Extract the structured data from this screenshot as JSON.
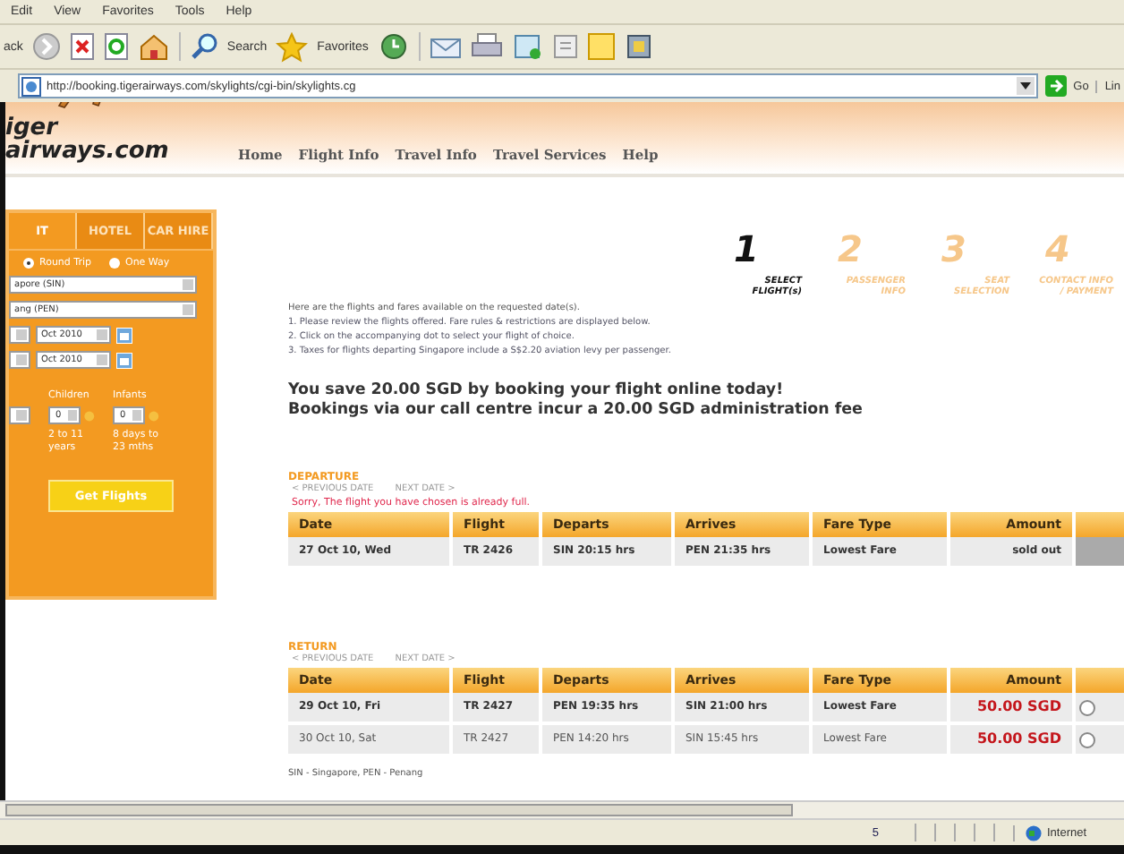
{
  "menu": [
    "Edit",
    "View",
    "Favorites",
    "Tools",
    "Help"
  ],
  "toolbar": {
    "back": "ack",
    "search": "Search",
    "favorites": "Favorites"
  },
  "address": {
    "url": "http://booking.tigerairways.com/skylights/cgi-bin/skylights.cg",
    "go": "Go",
    "links": "Lin"
  },
  "site": {
    "logo_top": "iger",
    "logo_bottom": "airways.com",
    "nav": [
      "Home",
      "Flight Info",
      "Travel Info",
      "Travel Services",
      "Help"
    ]
  },
  "booking_panel": {
    "tabs": [
      {
        "label": "IT",
        "selected": true
      },
      {
        "label": "HOTEL",
        "selected": false
      },
      {
        "label": "CAR HIRE",
        "selected": false
      }
    ],
    "trip_types": [
      {
        "label": "Round Trip",
        "selected": true
      },
      {
        "label": "One Way",
        "selected": false
      }
    ],
    "origin": "apore (SIN)",
    "destination": "ang (PEN)",
    "depart_month": "Oct 2010",
    "return_month": "Oct 2010",
    "passengers": [
      {
        "label": "Children",
        "value": "0",
        "note": "2 to 11 years"
      },
      {
        "label": "Infants",
        "value": "0",
        "note": "8 days to 23 mths"
      }
    ],
    "submit": "Get Flights"
  },
  "steps": [
    {
      "number": "1",
      "label": "SELECT FLIGHT(s)",
      "selected": true
    },
    {
      "number": "2",
      "label": "PASSENGER INFO",
      "selected": false
    },
    {
      "number": "3",
      "label": "SEAT SELECTION",
      "selected": false
    },
    {
      "number": "4",
      "label": "CONTACT INFO / PAYMENT",
      "selected": false
    }
  ],
  "intro": "Here are the flights and fares available on the requested date(s).",
  "instructions": [
    "1.  Please review the flights offered. Fare rules & restrictions are displayed below.",
    "2.  Click on the accompanying dot to select your flight of choice.",
    "3.  Taxes for flights departing Singapore include a S$2.20 aviation levy per passenger."
  ],
  "promo": [
    "You save 20.00 SGD by booking your flight online today!",
    "Bookings via our call centre incur a 20.00 SGD administration fee"
  ],
  "departure": {
    "title": "DEPARTURE",
    "prev": "< PREVIOUS DATE",
    "next": "NEXT DATE >",
    "message": "Sorry, The flight you have chosen is already full.",
    "columns": [
      "Date",
      "Flight",
      "Departs",
      "Arrives",
      "Fare Type",
      "Amount"
    ],
    "rows": [
      {
        "kind": "soldout",
        "selected": true,
        "cells": [
          "27 Oct 10, Wed",
          "TR 2426",
          "SIN 20:15 hrs",
          "PEN 21:35 hrs",
          "Lowest Fare",
          "sold out"
        ]
      }
    ]
  },
  "return": {
    "title": "RETURN",
    "prev": "< PREVIOUS DATE",
    "next": "NEXT DATE >",
    "columns": [
      "Date",
      "Flight",
      "Departs",
      "Arrives",
      "Fare Type",
      "Amount"
    ],
    "rows": [
      {
        "kind": "fare",
        "selected": true,
        "cells": [
          "29 Oct 10, Fri",
          "TR 2427",
          "PEN 19:35 hrs",
          "SIN 21:00 hrs",
          "Lowest Fare",
          "50.00 SGD"
        ]
      },
      {
        "kind": "fare",
        "selected": false,
        "cells": [
          "30 Oct 10, Sat",
          "TR 2427",
          "PEN 14:20 hrs",
          "SIN 15:45 hrs",
          "Lowest Fare",
          "50.00 SGD"
        ]
      }
    ]
  },
  "legend": "SIN - Singapore, PEN - Penang",
  "status": {
    "page": "5",
    "zone": "Internet"
  }
}
